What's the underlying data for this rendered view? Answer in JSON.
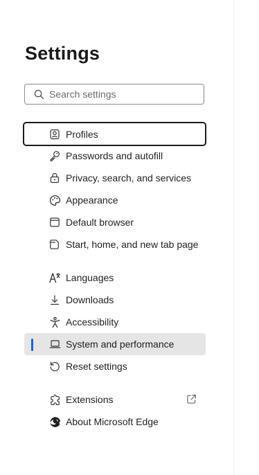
{
  "title": "Settings",
  "search": {
    "placeholder": "Search settings"
  },
  "nav": [
    {
      "label": "Profiles",
      "icon": "profile-icon",
      "state": "focused"
    },
    {
      "label": "Passwords and autofill",
      "icon": "key-icon"
    },
    {
      "label": "Privacy, search, and services",
      "icon": "lock-icon"
    },
    {
      "label": "Appearance",
      "icon": "palette-icon"
    },
    {
      "label": "Default browser",
      "icon": "browser-icon"
    },
    {
      "label": "Start, home, and new tab page",
      "icon": "home-tab-icon"
    },
    {
      "label": "Languages",
      "icon": "language-icon"
    },
    {
      "label": "Downloads",
      "icon": "download-icon"
    },
    {
      "label": "Accessibility",
      "icon": "accessibility-icon"
    },
    {
      "label": "System and performance",
      "icon": "laptop-icon",
      "state": "selected"
    },
    {
      "label": "Reset settings",
      "icon": "reset-icon"
    },
    {
      "label": "Extensions",
      "icon": "puzzle-icon",
      "external": "open-external-icon"
    },
    {
      "label": "About Microsoft Edge",
      "icon": "edge-logo-icon"
    }
  ],
  "colors": {
    "accent": "#1a66d6",
    "selected_bg": "#e5e5e5"
  }
}
